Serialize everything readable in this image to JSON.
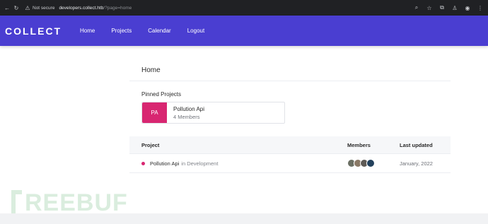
{
  "browser": {
    "security_label": "Not secure",
    "domain": "developers.collect.htb",
    "path": "/?page=home",
    "icons": [
      "back-arrow-icon",
      "reload-icon",
      "warning-icon",
      "zoom-icon",
      "star-icon",
      "extensions-icon",
      "profile-icon",
      "account-icon",
      "menu-icon"
    ]
  },
  "nav": {
    "brand": "COLLECT",
    "links": [
      "Home",
      "Projects",
      "Calendar",
      "Logout"
    ]
  },
  "page": {
    "title": "Home"
  },
  "pinned": {
    "heading": "Pinned Projects",
    "projects": [
      {
        "initials": "PA",
        "name": "Pollution Api",
        "members": "4 Members",
        "color": "#d82671"
      }
    ]
  },
  "table": {
    "headers": {
      "project": "Project",
      "members": "Members",
      "updated": "Last updated"
    },
    "rows": [
      {
        "name": "Pollution Api",
        "status_prefix": "in",
        "status": "Development",
        "updated": "January, 2022",
        "dot_color": "#d82671",
        "member_colors": [
          "#6b6f63",
          "#8a7966",
          "#5e5a55",
          "#23415c"
        ]
      }
    ]
  },
  "watermark": {
    "text": "REEBUF"
  },
  "colors": {
    "accent": "#4a3ed1",
    "pin": "#d82671"
  }
}
